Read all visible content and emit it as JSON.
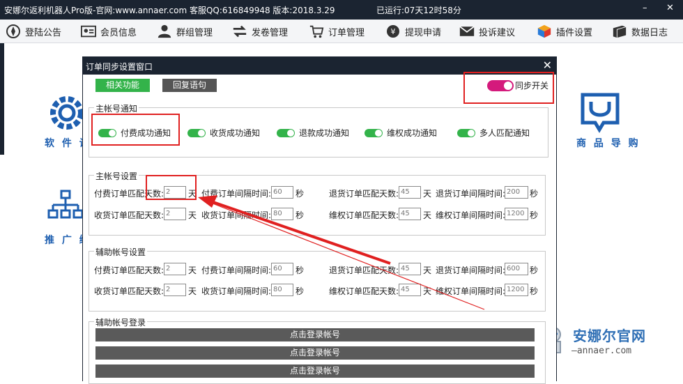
{
  "titlebar": {
    "title": "安娜尔返利机器人Pro版-官网:www.annaer.com 客服QQ:616849948 版本:2018.3.29",
    "runtime": "已运行:07天12时58分",
    "minimize": "–",
    "close": "✕"
  },
  "menu": [
    {
      "label": "登陆公告",
      "icon": "login-notice-icon"
    },
    {
      "label": "会员信息",
      "icon": "member-card-icon"
    },
    {
      "label": "群组管理",
      "icon": "group-users-icon"
    },
    {
      "label": "发卷管理",
      "icon": "coupon-arrows-icon"
    },
    {
      "label": "订单管理",
      "icon": "cart-icon"
    },
    {
      "label": "提现申请",
      "icon": "yen-coin-icon"
    },
    {
      "label": "投诉建议",
      "icon": "mail-icon"
    },
    {
      "label": "插件设置",
      "icon": "plugin-cube-icon"
    },
    {
      "label": "数据日志",
      "icon": "database-icon"
    }
  ],
  "background": {
    "left_labels": [
      "软 件 设",
      "推 广 绑"
    ],
    "right_label": "商 品 导 购"
  },
  "dialog": {
    "title": "订单同步设置窗口",
    "close": "✕",
    "tab_functions": "相关功能",
    "tab_replies": "回复语句",
    "sync_label": "同步开关",
    "main_notify": {
      "legend": "主帐号通知",
      "items": [
        "付费成功通知",
        "收货成功通知",
        "退款成功通知",
        "维权成功通知",
        "多人匹配通知"
      ]
    },
    "main_settings": {
      "legend": "主帐号设置",
      "row1": {
        "a_label": "付费订单匹配天数:",
        "a_val": "2",
        "a_unit": "天",
        "b_label": "付费订单间隔时间:",
        "b_val": "60",
        "b_unit": "秒",
        "c_label": "退货订单匹配天数:",
        "c_val": "45",
        "c_unit": "天",
        "d_label": "退货订单间隔时间:",
        "d_val": "200",
        "d_unit": "秒"
      },
      "row2": {
        "a_label": "收货订单匹配天数:",
        "a_val": "2",
        "a_unit": "天",
        "b_label": "收货订单间隔时间:",
        "b_val": "80",
        "b_unit": "秒",
        "c_label": "维权订单匹配天数:",
        "c_val": "45",
        "c_unit": "天",
        "d_label": "维权订单间隔时间:",
        "d_val": "1200",
        "d_unit": "秒"
      }
    },
    "aux_settings": {
      "legend": "辅助帐号设置",
      "row1": {
        "a_label": "付费订单匹配天数:",
        "a_val": "2",
        "a_unit": "天",
        "b_label": "付费订单间隔时间:",
        "b_val": "60",
        "b_unit": "秒",
        "c_label": "退货订单匹配天数:",
        "c_val": "45",
        "c_unit": "天",
        "d_label": "退货订单间隔时间:",
        "d_val": "600",
        "d_unit": "秒"
      },
      "row2": {
        "a_label": "收货订单匹配天数:",
        "a_val": "2",
        "a_unit": "天",
        "b_label": "收货订单间隔时间:",
        "b_val": "80",
        "b_unit": "秒",
        "c_label": "维权订单匹配天数:",
        "c_val": "45",
        "c_unit": "天",
        "d_label": "维权订单间隔时间:",
        "d_val": "1200",
        "d_unit": "秒"
      }
    },
    "aux_login": {
      "legend": "辅助帐号登录",
      "buttons": [
        "点击登录帐号",
        "点击登录帐号",
        "点击登录帐号"
      ]
    }
  },
  "watermark": {
    "name": "安娜尔官网",
    "url": "—annaer.com"
  },
  "colors": {
    "titlebar": "#1b2431",
    "green": "#33b34a",
    "pink_toggle": "#d41a7c",
    "highlight_red": "#e02020",
    "icon_blue": "#1e5fb0"
  }
}
